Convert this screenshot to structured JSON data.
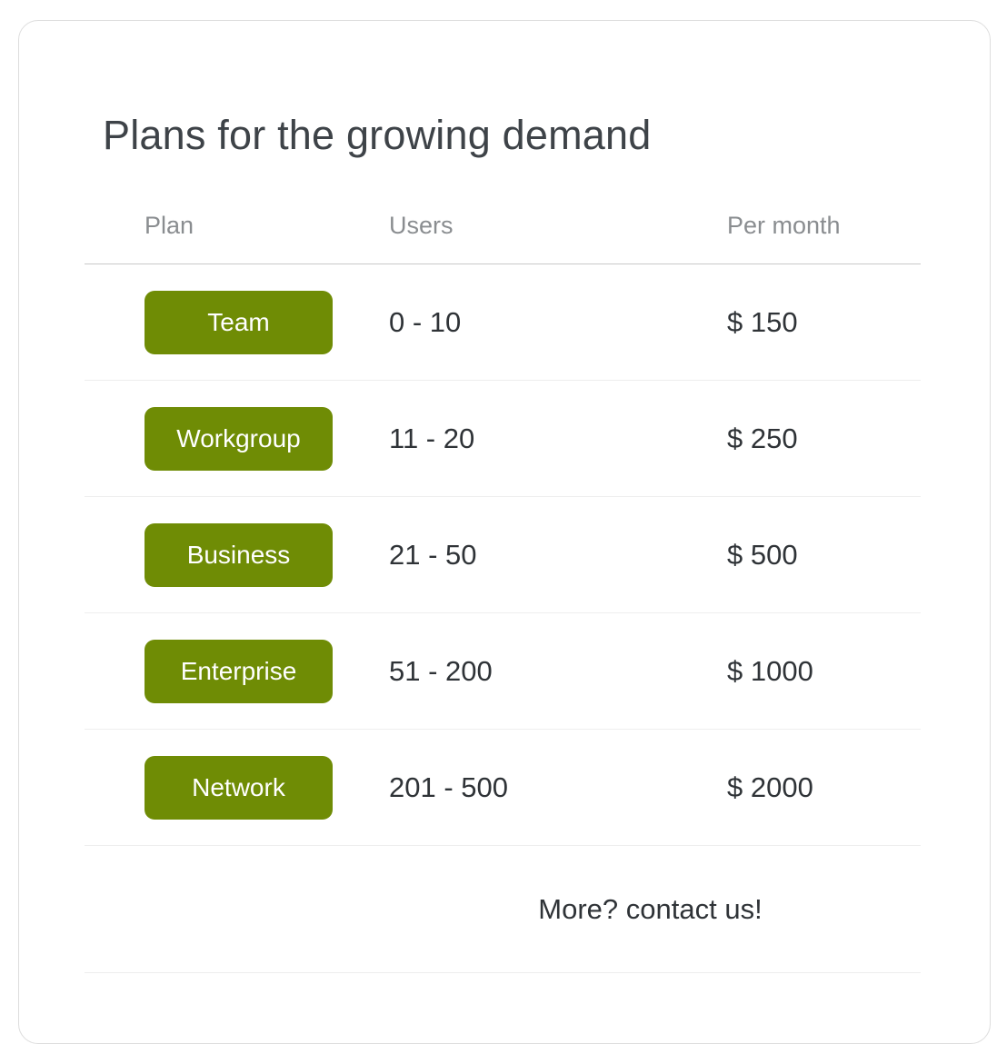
{
  "card": {
    "title": "Plans for the growing demand",
    "accent_color": "#6f8c05",
    "title_color": "#3e4348",
    "header_color": "#8a8d90",
    "value_color": "#2f3337",
    "border_color": "#dddddd"
  },
  "table": {
    "headers": {
      "plan": "Plan",
      "users": "Users",
      "price": "Per month"
    },
    "rows": [
      {
        "plan": "Team",
        "users": "0 - 10",
        "price": "$ 150"
      },
      {
        "plan": "Workgroup",
        "users": "11 - 20",
        "price": "$ 250"
      },
      {
        "plan": "Business",
        "users": "21 - 50",
        "price": "$ 500"
      },
      {
        "plan": "Enterprise",
        "users": "51 - 200",
        "price": "$ 1000"
      },
      {
        "plan": "Network",
        "users": "201 - 500",
        "price": "$ 2000"
      }
    ],
    "footer_note": "More? contact us!"
  }
}
